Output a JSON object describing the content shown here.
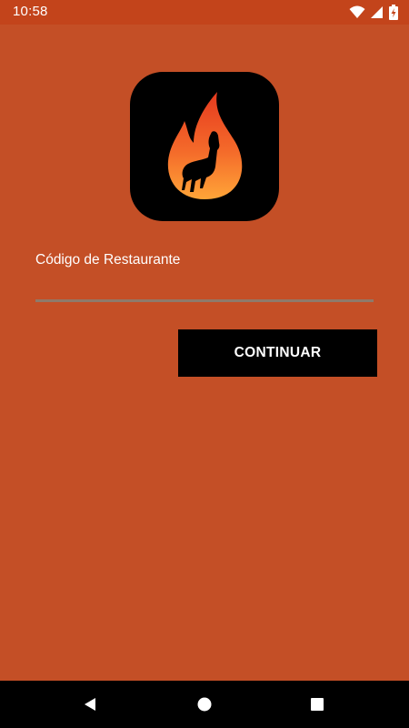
{
  "status_bar": {
    "time": "10:58",
    "icons": [
      "wifi-icon",
      "cell-signal-icon",
      "battery-charging-icon"
    ]
  },
  "logo": {
    "icon": "flame-llama-logo",
    "colors": {
      "background": "#000000",
      "flame_top": "#E63A1F",
      "flame_bottom": "#FFA538"
    }
  },
  "form": {
    "label": "Código de Restaurante",
    "value": "",
    "placeholder": ""
  },
  "button": {
    "label": "CONTINUAR"
  },
  "nav_bar": {
    "icons": [
      "back-icon",
      "home-icon",
      "recents-icon"
    ]
  },
  "colors": {
    "background": "#C44F26",
    "status_bar": "#C3441B",
    "button": "#000000",
    "input_underline": "#8F7A6A"
  }
}
